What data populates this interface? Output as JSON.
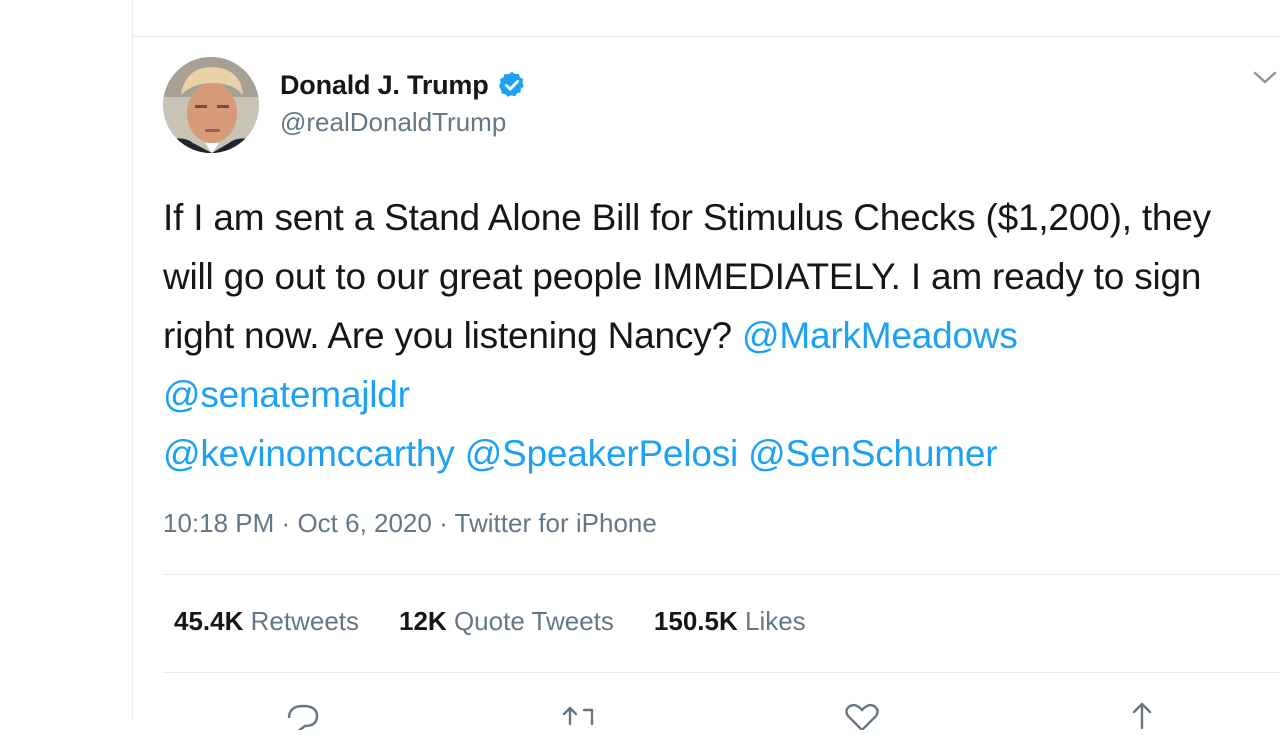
{
  "author": {
    "name": "Donald J. Trump",
    "handle": "@realDonaldTrump",
    "verified": true
  },
  "tweet": {
    "text_segments": [
      {
        "text": "If I am sent a Stand Alone Bill for Stimulus Checks ($1,200), they will go out to our great people IMMEDIATELY. I am ready to sign right now. Are you listening Nancy? ",
        "type": "text"
      },
      {
        "text": "@MarkMeadows",
        "type": "mention"
      },
      {
        "text": " ",
        "type": "text"
      },
      {
        "text": "@senatemajldr",
        "type": "mention"
      },
      {
        "text": " ",
        "type": "text"
      },
      {
        "text": "@kevinomccarthy",
        "type": "mention"
      },
      {
        "text": " ",
        "type": "text"
      },
      {
        "text": "@SpeakerPelosi",
        "type": "mention"
      },
      {
        "text": " ",
        "type": "text"
      },
      {
        "text": "@SenSchumer",
        "type": "mention"
      }
    ]
  },
  "meta": {
    "time": "10:18 PM",
    "date": "Oct 6, 2020",
    "source": "Twitter for iPhone",
    "separator": "·"
  },
  "stats": {
    "retweets": {
      "count": "45.4K",
      "label": "Retweets"
    },
    "quote_tweets": {
      "count": "12K",
      "label": "Quote Tweets"
    },
    "likes": {
      "count": "150.5K",
      "label": "Likes"
    }
  },
  "actions": [
    "reply-icon",
    "retweet-icon",
    "like-icon",
    "share-icon"
  ],
  "colors": {
    "accent": "#1da1f2",
    "text_primary": "#14171a",
    "text_secondary": "#657786",
    "border": "#e6ecf0"
  }
}
